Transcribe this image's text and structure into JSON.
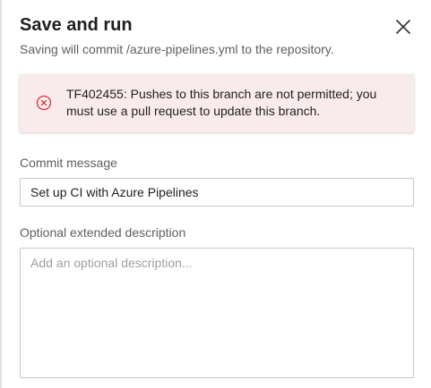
{
  "dialog": {
    "title": "Save and run",
    "subtitle": "Saving will commit /azure-pipelines.yml to the repository.",
    "close_icon": "close-icon"
  },
  "error": {
    "message": "TF402455: Pushes to this branch are not permitted; you must use a pull request to update this branch.",
    "icon": "error-circle-icon",
    "color": "#d13438",
    "background": "#f9ebeb"
  },
  "commit": {
    "label": "Commit message",
    "value": "Set up CI with Azure Pipelines"
  },
  "description": {
    "label": "Optional extended description",
    "placeholder": "Add an optional description..."
  }
}
